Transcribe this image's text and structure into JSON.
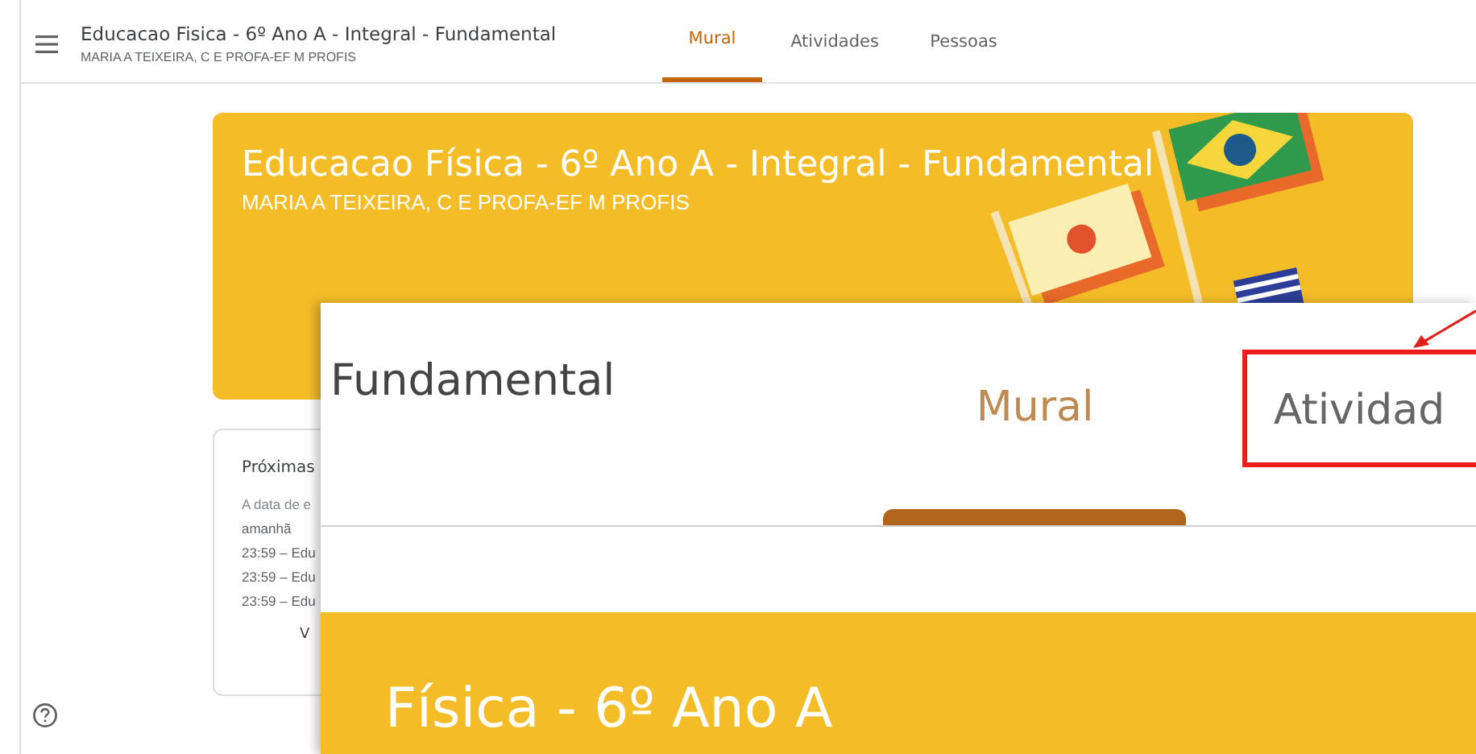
{
  "header": {
    "title": "Educacao Fisica - 6º Ano A - Integral - Fundamental",
    "subtitle": "MARIA A TEIXEIRA, C E PROFA-EF M PROFIS"
  },
  "tabs": [
    {
      "label": "Mural",
      "selected": true
    },
    {
      "label": "Atividades",
      "selected": false
    },
    {
      "label": "Pessoas",
      "selected": false
    }
  ],
  "banner": {
    "title": "Educacao Física - 6º Ano A - Integral - Fundamental",
    "subtitle": "MARIA A TEIXEIRA, C E PROFA-EF M PROFIS"
  },
  "upcoming_card": {
    "title": "Próximas",
    "lines": [
      "A data de e",
      "amanhã",
      "23:59 – Edu",
      "23:59 – Edu",
      "23:59 – Edu"
    ],
    "link": "V"
  },
  "zoom_inset": {
    "title": "Fundamental",
    "tabs": [
      {
        "label": "Mural",
        "selected": true,
        "highlighted": false
      },
      {
        "label": "Atividad",
        "selected": false,
        "highlighted": true
      }
    ],
    "banner_title": "Física - 6º Ano A"
  }
}
